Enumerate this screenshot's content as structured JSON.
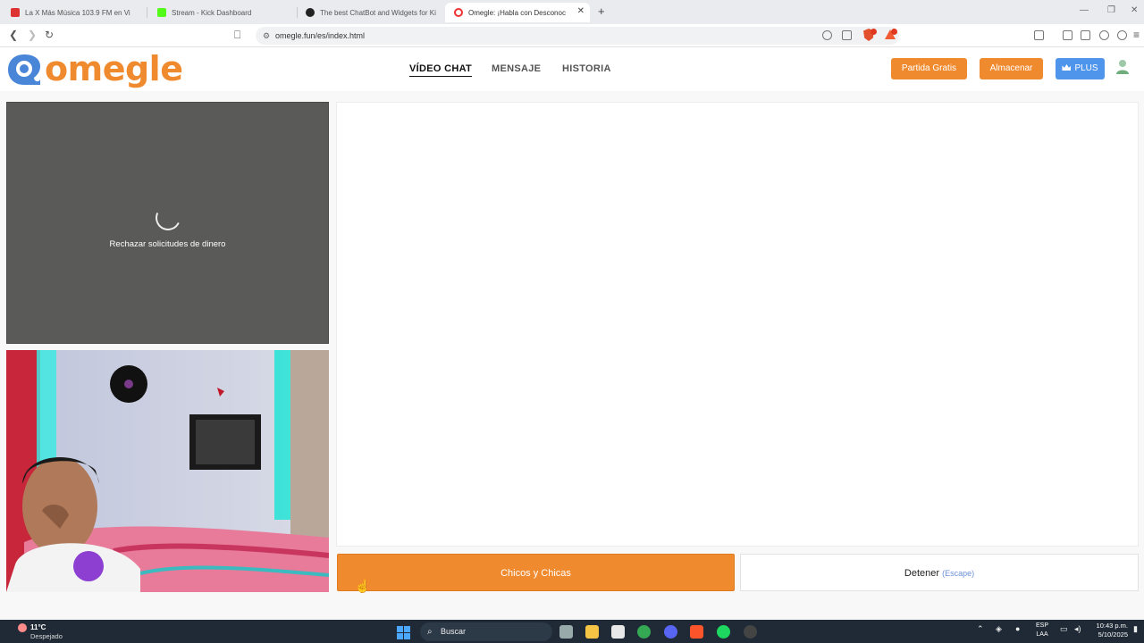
{
  "browser": {
    "tabs": [
      {
        "title": "La X Más Música 103.9 FM en Vi",
        "active": false
      },
      {
        "title": "Stream - Kick Dashboard",
        "active": false
      },
      {
        "title": "The best ChatBot and Widgets for Ki",
        "active": false
      },
      {
        "title": "Omegle: ¡Habla con Desconoc",
        "active": true
      }
    ],
    "new_tab_label": "+",
    "url": "omegle.fun/es/index.html"
  },
  "site": {
    "logo_text": "omegle",
    "nav": [
      {
        "label": "VÍDEO CHAT",
        "active": true
      },
      {
        "label": "MENSAJE",
        "active": false
      },
      {
        "label": "HISTORIA",
        "active": false
      }
    ],
    "buttons": {
      "free_game": "Partida Gratis",
      "store": "Almacenar",
      "plus": "PLUS"
    }
  },
  "video": {
    "remote_message": "Rechazar solicitudes de dinero"
  },
  "controls": {
    "start_label": "Chicos y Chicas",
    "stop_label": "Detener",
    "stop_hint": "(Escape)"
  },
  "taskbar": {
    "temperature": "11°C",
    "weather": "Despejado",
    "search_label": "Buscar",
    "language": "ESP",
    "layout": "LAA",
    "time": "10:43 p.m.",
    "date": "5/10/2025"
  },
  "colors": {
    "brand_orange": "#f08a2e",
    "plus_blue": "#4f95ec",
    "logo_blue": "#4a86d8"
  }
}
